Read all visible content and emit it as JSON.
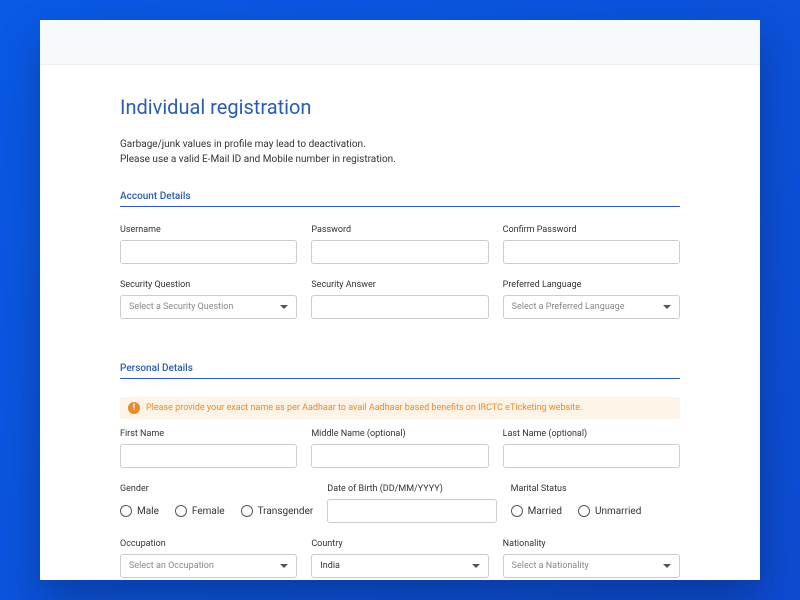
{
  "page": {
    "title": "Individual registration",
    "intro_line1": "Garbage/junk values in profile may lead to deactivation.",
    "intro_line2": "Please use a valid E-Mail ID and Mobile number in registration."
  },
  "sections": {
    "account": {
      "header": "Account Details"
    },
    "personal": {
      "header": "Personal Details"
    }
  },
  "account": {
    "username": {
      "label": "Username"
    },
    "password": {
      "label": "Password"
    },
    "confirm_password": {
      "label": "Confirm Password"
    },
    "security_question": {
      "label": "Security Question",
      "placeholder": "Select a Security Question"
    },
    "security_answer": {
      "label": "Security Answer"
    },
    "preferred_language": {
      "label": "Preferred Language",
      "placeholder": "Select a Preferred Language"
    }
  },
  "personal": {
    "alert": "Please provide your exact name as per Aadhaar to avail Aadhaar based benefits on IRCTC eTicketing website.",
    "first_name": {
      "label": "First Name"
    },
    "middle_name": {
      "label": "Middle Name (optional)"
    },
    "last_name": {
      "label": "Last Name (optional)"
    },
    "gender": {
      "label": "Gender",
      "options": {
        "male": "Male",
        "female": "Female",
        "transgender": "Transgender"
      }
    },
    "dob": {
      "label": "Date of Birth (DD/MM/YYYY)"
    },
    "marital_status": {
      "label": "Marital Status",
      "options": {
        "married": "Married",
        "unmarried": "Unmarried"
      }
    },
    "occupation": {
      "label": "Occupation",
      "placeholder": "Select an Occupation"
    },
    "country": {
      "label": "Country",
      "value": "India"
    },
    "nationality": {
      "label": "Nationality",
      "placeholder": "Select a Nationality"
    }
  }
}
